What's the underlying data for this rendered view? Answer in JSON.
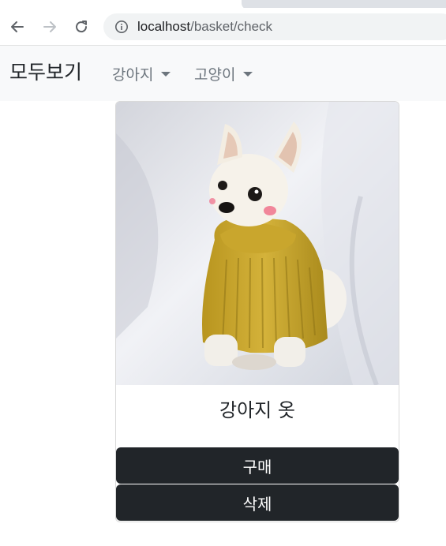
{
  "browser": {
    "url_host": "localhost",
    "url_path": "/basket/check"
  },
  "navbar": {
    "brand": "모두보기",
    "items": [
      {
        "label": "강아지",
        "icon": "caret-down-icon"
      },
      {
        "label": "고양이",
        "icon": "caret-down-icon"
      }
    ]
  },
  "product": {
    "name": "강아지 옷",
    "image": "white pomeranian puppy wearing a yellow knit sweater",
    "buy_label": "구매",
    "delete_label": "삭제"
  },
  "colors": {
    "navbar_bg": "#f8f9fa",
    "button_dark": "#212529",
    "nav_text": "#6c757d",
    "sweater": "#c9a62d"
  }
}
